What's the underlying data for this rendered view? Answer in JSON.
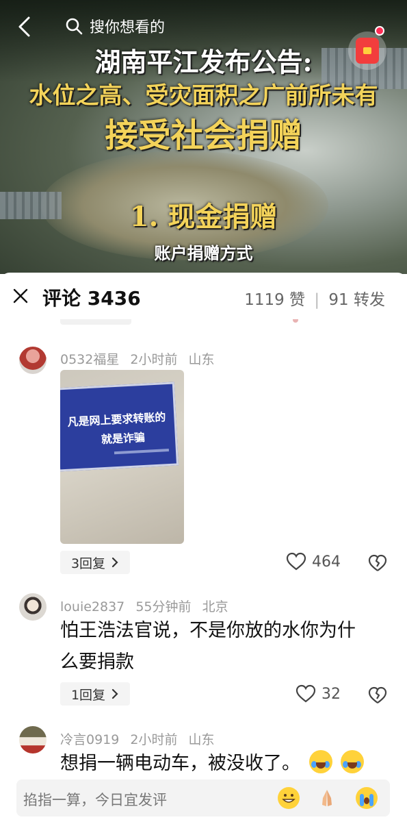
{
  "video": {
    "search_placeholder": "搜你想看的",
    "headline_1": "湖南平江发布公告:",
    "headline_2": "水位之高、受灾面积之广前所未有",
    "headline_3": "接受社会捐赠",
    "headline_4": "1. 现金捐赠",
    "headline_5": "账户捐赠方式"
  },
  "comments_panel": {
    "title": "评论 3436",
    "likes": "1119 赞",
    "separator": "|",
    "shares": "91 转发"
  },
  "comments": [
    {
      "username": "0532福星",
      "time": "2小时前",
      "location": "山东",
      "image_text_1": "凡是网上要求转账的",
      "image_text_2": "就是诈骗",
      "replies": "3回复",
      "like_count": "464"
    },
    {
      "username": "louie2837",
      "time": "55分钟前",
      "location": "北京",
      "text_line_1": "怕王浩法官说，不是你放的水你为什",
      "text_line_2": "么要捐款",
      "replies": "1回复",
      "like_count": "32"
    },
    {
      "username": "冷言0919",
      "time": "2小时前",
      "location": "山东",
      "text": "想捐一辆电动车，被没收了。"
    }
  ],
  "input": {
    "placeholder": "掐指一算，今日宜发评"
  }
}
